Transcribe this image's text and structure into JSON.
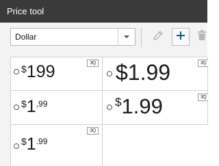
{
  "window": {
    "title": "Price tool"
  },
  "toolbar": {
    "format_select": {
      "value": "Dollar"
    },
    "buttons": [
      "edit-pencil",
      "add-plus",
      "delete-trash"
    ]
  },
  "styles": [
    {
      "symbol": "$",
      "integer": "1",
      "decimal_sep": "",
      "fraction": "99",
      "preview_label": "3Q"
    },
    {
      "symbol": "$",
      "integer": "1",
      "decimal_sep": ".",
      "fraction": "99",
      "preview_label": "3Q"
    },
    {
      "symbol": "$",
      "integer": "1",
      "decimal_sep": ",",
      "fraction": "99",
      "preview_label": ""
    },
    {
      "symbol": "$",
      "integer": "1",
      "decimal_sep": ".",
      "fraction": "99",
      "preview_label": "3Q"
    },
    {
      "symbol": "$",
      "integer": "1",
      "decimal_sep": ".",
      "fraction": "99",
      "preview_label": "3Q"
    }
  ],
  "colors": {
    "titlebar": "#3a3a3a",
    "background": "#f3f3f3",
    "accent_icon": "#0f5b8a",
    "pencil_icon": "#b7b7b7"
  }
}
